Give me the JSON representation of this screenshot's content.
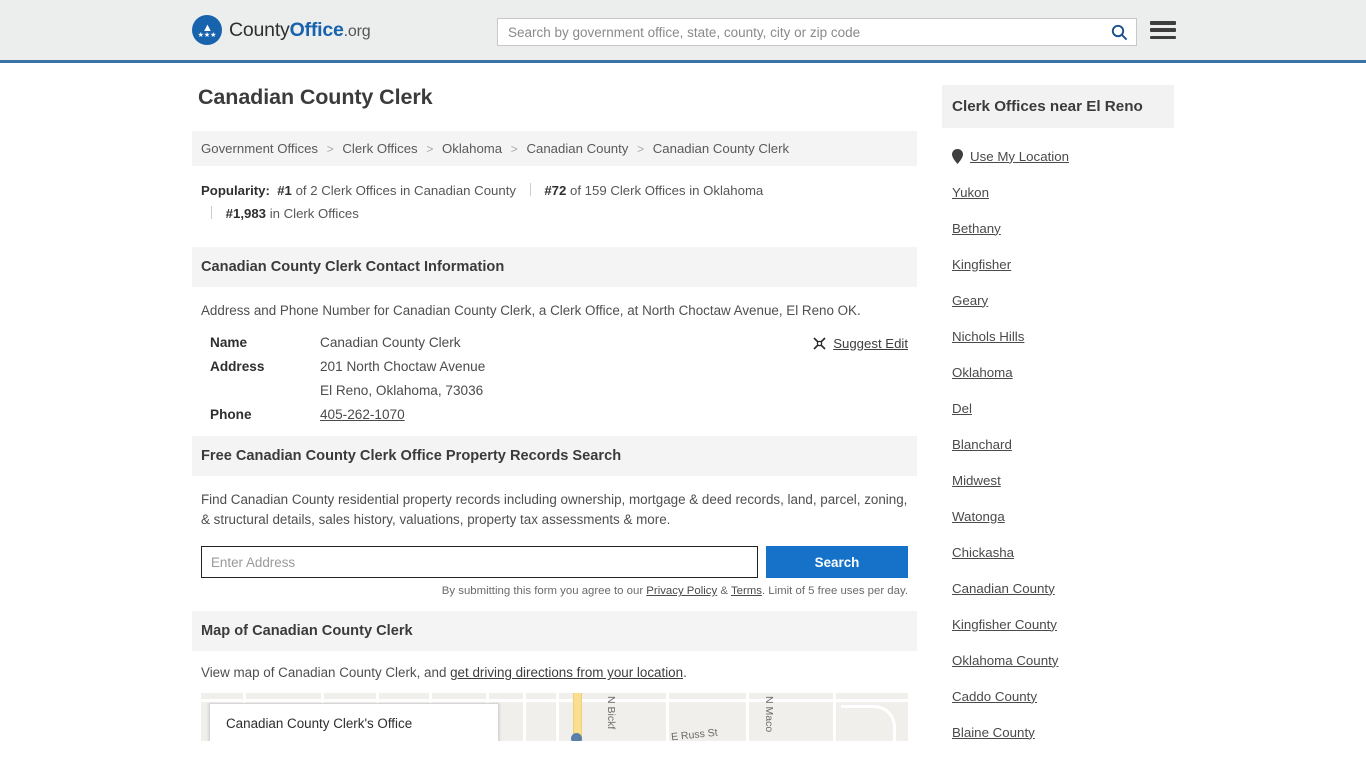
{
  "header": {
    "logo": {
      "part1": "County",
      "part2": "Office",
      "part3": ".org",
      "icon": "eagle-badge-icon",
      "stars": "★★★"
    },
    "search": {
      "placeholder": "Search by government office, state, county, city or zip code",
      "value": "",
      "icon": "search-icon"
    },
    "menu_icon": "hamburger-menu-icon"
  },
  "page": {
    "title": "Canadian County Clerk"
  },
  "breadcrumb": {
    "separator": ">",
    "items": [
      "Government Offices",
      "Clerk Offices",
      "Oklahoma",
      "Canadian County",
      "Canadian County Clerk"
    ]
  },
  "popularity": {
    "label": "Popularity:",
    "items": [
      {
        "rank": "#1",
        "rest": "of 2 Clerk Offices in Canadian County"
      },
      {
        "rank": "#72",
        "rest": "of 159 Clerk Offices in Oklahoma"
      },
      {
        "rank": "#1,983",
        "rest": "in Clerk Offices"
      }
    ]
  },
  "contact_section": {
    "heading": "Canadian County Clerk Contact Information",
    "description": "Address and Phone Number for Canadian County Clerk, a Clerk Office, at North Choctaw Avenue, El Reno OK.",
    "suggest_edit": {
      "label": "Suggest Edit",
      "icon": "pencil-edit-icon"
    },
    "rows": [
      {
        "label": "Name",
        "value": "Canadian County Clerk",
        "link": false
      },
      {
        "label": "Address",
        "value": "201 North Choctaw Avenue",
        "link": false
      },
      {
        "label": "",
        "value": "El Reno, Oklahoma, 73036",
        "link": false
      },
      {
        "label": "Phone",
        "value": "405-262-1070",
        "link": true
      }
    ]
  },
  "property_section": {
    "heading": "Free Canadian County Clerk Office Property Records Search",
    "description": "Find Canadian County residential property records including ownership, mortgage & deed records, land, parcel, zoning, & structural details, sales history, valuations, property tax assessments & more.",
    "input_placeholder": "Enter Address",
    "input_value": "",
    "button_label": "Search",
    "disclaimer_pre": "By submitting this form you agree to our ",
    "disclaimer_link1": "Privacy Policy",
    "disclaimer_amp": " & ",
    "disclaimer_link2": "Terms",
    "disclaimer_post": ". Limit of 5 free uses per day."
  },
  "map_section": {
    "heading": "Map of Canadian County Clerk",
    "description_pre": "View map of Canadian County Clerk, and ",
    "description_link": "get driving directions from your location",
    "description_post": ".",
    "card_title": "Canadian County Clerk's Office",
    "street_labels": [
      "N Bickf",
      "N Maco",
      "E Russ St"
    ]
  },
  "sidebar": {
    "heading": "Clerk Offices near El Reno",
    "use_my_location": {
      "label": "Use My Location",
      "icon": "map-pin-icon"
    },
    "items": [
      "Yukon",
      "Bethany",
      "Kingfisher",
      "Geary",
      "Nichols Hills",
      "Oklahoma",
      "Del",
      "Blanchard",
      "Midwest",
      "Watonga",
      "Chickasha",
      "Canadian County",
      "Kingfisher County",
      "Oklahoma County",
      "Caddo County",
      "Blaine County"
    ]
  },
  "colors": {
    "brand_blue": "#1763ad",
    "button_blue": "#1672c8",
    "header_bg": "#eceded",
    "header_border": "#3b73a6",
    "section_bg": "#f4f4f4"
  }
}
